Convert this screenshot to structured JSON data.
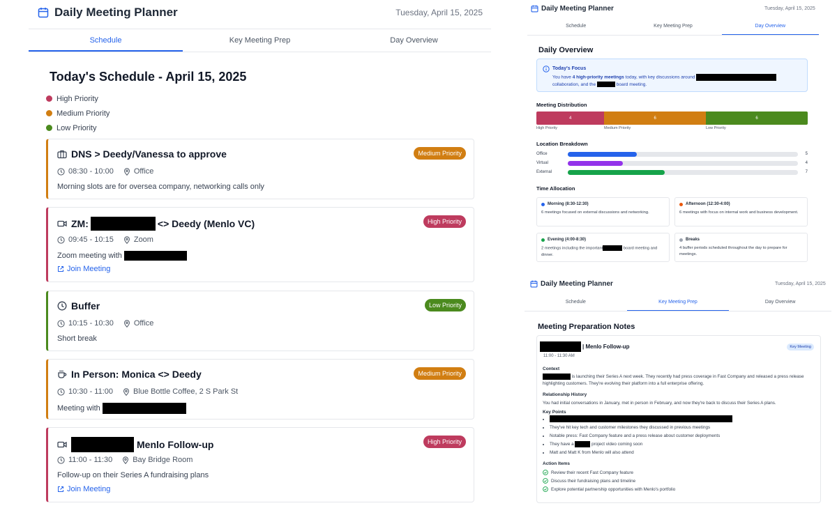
{
  "left": {
    "app_title": "Daily Meeting Planner",
    "date": "Tuesday, April 15, 2025",
    "tabs": [
      {
        "label": "Schedule",
        "active": true
      },
      {
        "label": "Key Meeting Prep",
        "active": false
      },
      {
        "label": "Day Overview",
        "active": false
      }
    ],
    "schedule_title": "Today's Schedule - April 15, 2025",
    "legend": [
      {
        "label": "High Priority",
        "color": "#be3b5e"
      },
      {
        "label": "Medium Priority",
        "color": "#d17e12"
      },
      {
        "label": "Low Priority",
        "color": "#4b8a1e"
      }
    ],
    "meetings": [
      {
        "icon": "briefcase-icon",
        "title": "DNS > Deedy/Vanessa to approve",
        "time": "08:30 - 10:00",
        "location": "Office",
        "description": "Morning slots are for oversea company, networking calls only",
        "priority": "Medium Priority",
        "priority_color": "#d17e12"
      },
      {
        "icon": "video-icon",
        "title_prefix": "ZM:",
        "title_suffix": "<> Deedy (Menlo VC)",
        "time": "09:45 - 10:15",
        "location": "Zoom",
        "description": "Zoom meeting with",
        "join": "Join Meeting",
        "priority": "High Priority",
        "priority_color": "#be3b5e"
      },
      {
        "icon": "clock-icon",
        "title": "Buffer",
        "time": "10:15 - 10:30",
        "location": "Office",
        "description": "Short break",
        "priority": "Low Priority",
        "priority_color": "#4b8a1e"
      },
      {
        "icon": "coffee-icon",
        "title": "In Person: Monica <> Deedy",
        "time": "10:30 - 11:00",
        "location": "Blue Bottle Coffee, 2 S Park St",
        "description": "Meeting with",
        "priority": "Medium Priority",
        "priority_color": "#d17e12"
      },
      {
        "icon": "video-icon",
        "title_suffix": "Menlo Follow-up",
        "time": "11:00 - 11:30",
        "location": "Bay Bridge Room",
        "description": "Follow-up on their Series A fundraising plans",
        "join": "Join Meeting",
        "priority": "High Priority",
        "priority_color": "#be3b5e"
      }
    ]
  },
  "overview": {
    "app_title": "Daily Meeting Planner",
    "date": "Tuesday, April 15, 2025",
    "tabs": [
      {
        "label": "Schedule",
        "active": false
      },
      {
        "label": "Key Meeting Prep",
        "active": false
      },
      {
        "label": "Day Overview",
        "active": true
      }
    ],
    "heading": "Daily Overview",
    "focus_title": "Today's Focus",
    "focus_text_1": "You have",
    "focus_bold": "4 high-priority meetings",
    "focus_text_2": "today, with key discussions around",
    "focus_text_3": "collaboration, and the",
    "focus_text_4": "board meeting.",
    "distribution_label": "Meeting Distribution",
    "distribution": [
      {
        "label": "High Priority",
        "value": 4,
        "color": "#be3b5e"
      },
      {
        "label": "Medium Priority",
        "value": 6,
        "color": "#d17e12"
      },
      {
        "label": "Low Priority",
        "value": 6,
        "color": "#4b8a1e"
      }
    ],
    "location_label": "Location Breakdown",
    "locations": [
      {
        "label": "Office",
        "value": 5,
        "fraction": 0.3,
        "color": "#2563eb"
      },
      {
        "label": "Virtual",
        "value": 4,
        "fraction": 0.24,
        "color": "#9333ea"
      },
      {
        "label": "External",
        "value": 7,
        "fraction": 0.42,
        "color": "#16a34a"
      }
    ],
    "time_label": "Time Allocation",
    "time_blocks": [
      {
        "title": "Morning (8:30-12:30)",
        "text": "6 meetings focused on external discussions and networking.",
        "color": "#2563eb"
      },
      {
        "title": "Afternoon (12:30-4:00)",
        "text": "6 meetings with focus on internal work and business development.",
        "color": "#ea580c"
      },
      {
        "title": "Evening (4:00-8:30)",
        "text_1": "2 meetings including the important",
        "text_2": "board meeting and dinner.",
        "color": "#16a34a"
      },
      {
        "title": "Breaks",
        "text": "4 buffer periods scheduled throughout the day to prepare for meetings.",
        "color": "#9ca3af"
      }
    ]
  },
  "prep": {
    "app_title": "Daily Meeting Planner",
    "date": "Tuesday, April 15, 2025",
    "tabs": [
      {
        "label": "Schedule",
        "active": false
      },
      {
        "label": "Key Meeting Prep",
        "active": true
      },
      {
        "label": "Day Overview",
        "active": false
      }
    ],
    "heading": "Meeting Preparation Notes",
    "meeting_title": "| Menlo Follow-up",
    "meeting_time": "11:00 - 11:30 AM",
    "badge": "Key Meeting",
    "context_label": "Context",
    "context_text": "is launching their Series A next week. They recently had press coverage in Fast Company and released a press release highlighting customers. They're evolving their platform into a full enterprise offering.",
    "history_label": "Relationship History",
    "history_text": "You had initial conversations in January, met in person in February, and now they're back to discuss their Series A plans.",
    "points_label": "Key Points",
    "points": [
      "",
      "They've hit key tech and customer milestones they discussed in previous meetings",
      "Notable press: Fast Company feature and a press release about customer deployments",
      "They have a",
      "Matt and Matt K from Menlo will also attend"
    ],
    "point_4_suffix": "project video coming soon",
    "actions_label": "Action Items",
    "actions": [
      "Review their recent Fast Company feature",
      "Discuss their fundraising plans and timeline",
      "Explore potential partnership opportunities with Menlo's portfolio"
    ]
  }
}
